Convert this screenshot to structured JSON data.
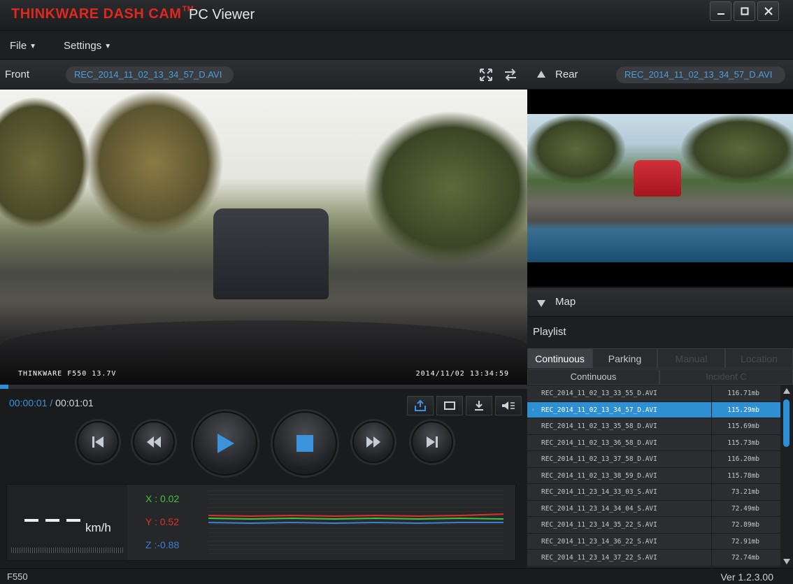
{
  "title": {
    "brand": "THINKWARE DASH CAM",
    "trademark": "TM",
    "app": "PC Viewer",
    "window_buttons": [
      "minimize-icon",
      "maximize-icon",
      "close-icon"
    ]
  },
  "menu": {
    "file": "File",
    "settings": "Settings"
  },
  "front": {
    "label": "Front",
    "file": "REC_2014_11_02_13_34_57_D.AVI",
    "osd_left": "THINKWARE F550 13.7V",
    "osd_right": "2014/11/02  13:34:59"
  },
  "rear": {
    "label": "Rear",
    "file": "REC_2014_11_02_13_34_57_D.AVI"
  },
  "playback": {
    "current_time": "00:00:01",
    "separator": " / ",
    "total_time": "00:01:01",
    "progress_fraction": 0.016
  },
  "sensor": {
    "speed": "- - -",
    "unit": "km/h",
    "x": "X : 0.02",
    "y": "Y : 0.52",
    "z": "Z :-0.88",
    "x_color": "#3ec43e",
    "y_color": "#e0302a",
    "z_color": "#3a7fd8"
  },
  "map": {
    "label": "Map"
  },
  "playlist": {
    "title": "Playlist",
    "tabs": [
      "Continuous",
      "Parking",
      "Manual",
      "Location"
    ],
    "subtabs": [
      "Continuous",
      "Incident C"
    ],
    "files": [
      {
        "name": "REC_2014_11_02_13_33_55_D.AVI",
        "size": "116.71mb"
      },
      {
        "name": "REC_2014_11_02_13_34_57_D.AVI",
        "size": "115.29mb"
      },
      {
        "name": "REC_2014_11_02_13_35_58_D.AVI",
        "size": "115.69mb"
      },
      {
        "name": "REC_2014_11_02_13_36_58_D.AVI",
        "size": "115.73mb"
      },
      {
        "name": "REC_2014_11_02_13_37_58_D.AVI",
        "size": "116.20mb"
      },
      {
        "name": "REC_2014_11_02_13_38_59_D.AVI",
        "size": "115.78mb"
      },
      {
        "name": "REC_2014_11_23_14_33_03_S.AVI",
        "size": "73.21mb"
      },
      {
        "name": "REC_2014_11_23_14_34_04_S.AVI",
        "size": "72.49mb"
      },
      {
        "name": "REC_2014_11_23_14_35_22_S.AVI",
        "size": "72.89mb"
      },
      {
        "name": "REC_2014_11_23_14_36_22_S.AVI",
        "size": "72.91mb"
      },
      {
        "name": "REC_2014_11_23_14_37_22_S.AVI",
        "size": "72.74mb"
      }
    ]
  },
  "status": {
    "model": "F550",
    "version": "Ver 1.2.3.00"
  },
  "colors": {
    "brand_red": "#e0281e",
    "accent_blue": "#2d8fd5"
  }
}
